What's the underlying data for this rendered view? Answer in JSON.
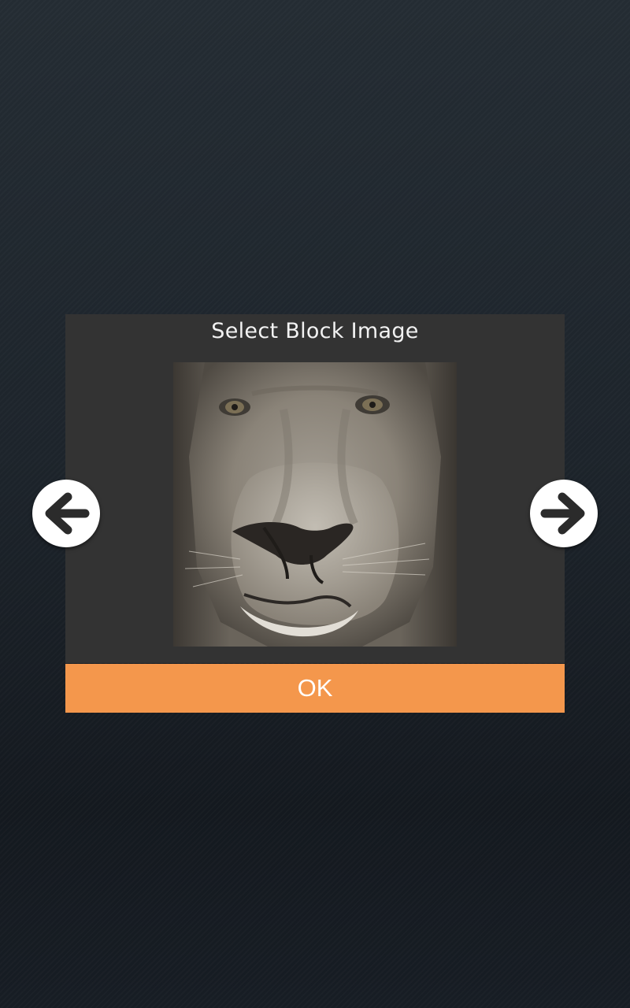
{
  "dialog": {
    "title": "Select Block Image",
    "image": {
      "subject": "lion-face"
    },
    "ok_label": "OK"
  },
  "navigation": {
    "previous_icon": "arrow-left-icon",
    "next_icon": "arrow-right-icon"
  },
  "colors": {
    "ok_button": "#f4974c",
    "dialog_background": "#333333",
    "title_text": "#f2f2f2",
    "nav_button": "#ffffff",
    "nav_arrow": "#2b2b2b"
  }
}
